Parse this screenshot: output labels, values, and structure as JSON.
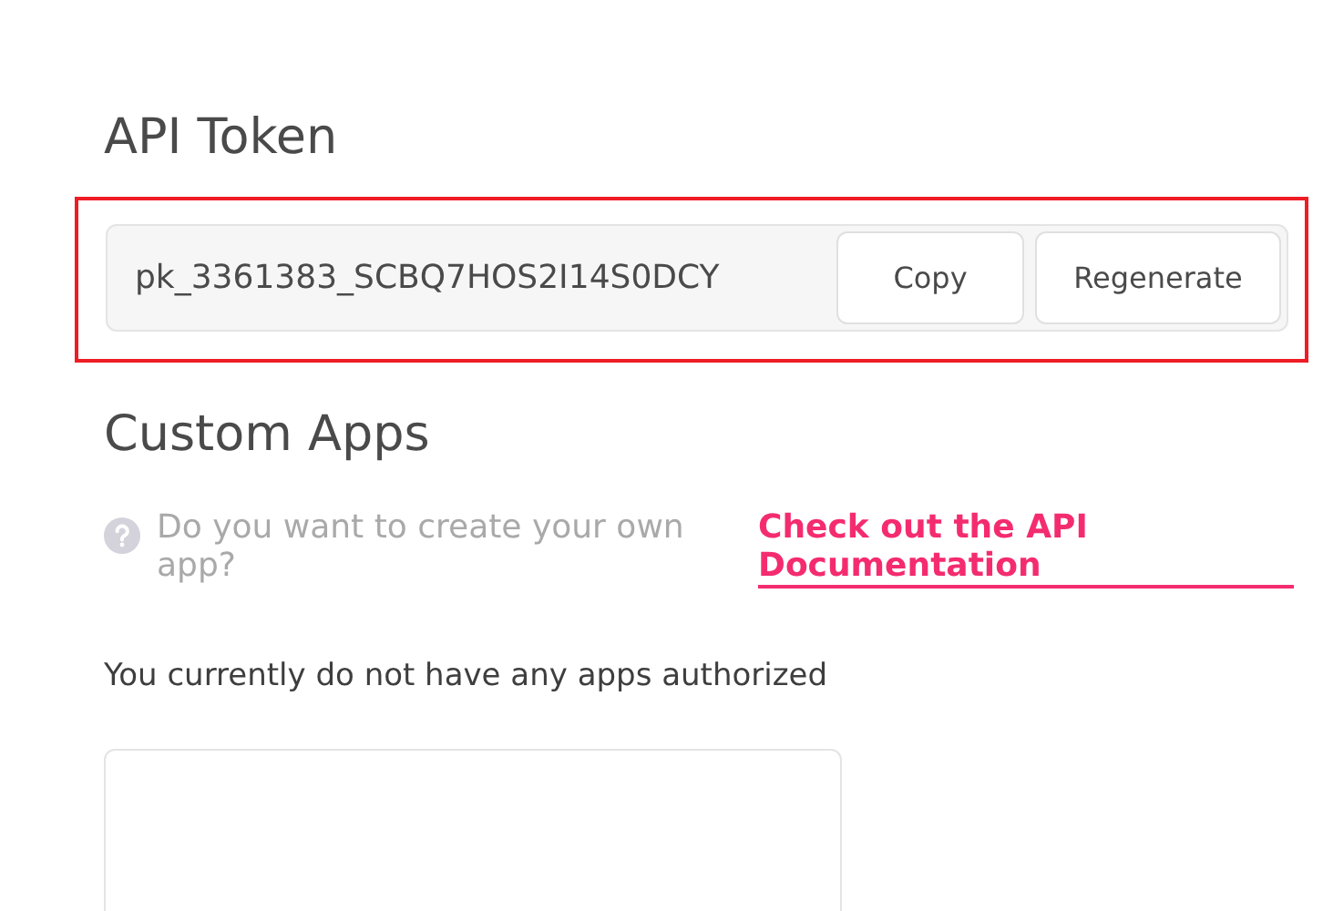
{
  "api_token": {
    "title": "API Token",
    "highlighted": true,
    "value": "pk_3361383_SCBQ7HOS2I14S0DCY",
    "buttons": [
      {
        "label": "Copy"
      },
      {
        "label": "Regenerate"
      }
    ]
  },
  "custom_apps": {
    "title": "Custom Apps",
    "help_text": "Do you want to create your own app?",
    "link": "Check out the API Documentation",
    "empty_message": "You currently do not have any apps authorized"
  }
}
